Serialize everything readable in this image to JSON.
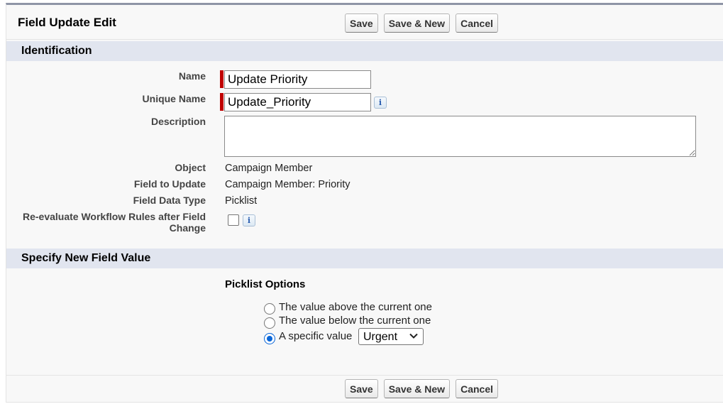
{
  "header": {
    "title": "Field Update Edit"
  },
  "buttons": {
    "save": "Save",
    "save_new": "Save & New",
    "cancel": "Cancel"
  },
  "identification": {
    "heading": "Identification",
    "name_label": "Name",
    "name_value": "Update Priority",
    "unique_name_label": "Unique Name",
    "unique_name_value": "Update_Priority",
    "description_label": "Description",
    "description_value": "",
    "object_label": "Object",
    "object_value": "Campaign Member",
    "field_to_update_label": "Field to Update",
    "field_to_update_value": "Campaign Member: Priority",
    "field_data_type_label": "Field Data Type",
    "field_data_type_value": "Picklist",
    "reevaluate_label_line1": "Re-evaluate Workflow Rules after Field",
    "reevaluate_label_line2": "Change",
    "reevaluate_checked": false,
    "info_icon_glyph": "i"
  },
  "new_value": {
    "heading": "Specify New Field Value",
    "picklist_options_title": "Picklist Options",
    "option_above": "The value above the current one",
    "option_below": "The value below the current one",
    "option_specific": "A specific value",
    "selected_option": "specific",
    "specific_value": "Urgent"
  },
  "colors": {
    "required_bar": "#c00000",
    "section_header_bg": "#e1e5ef",
    "radio_selected": "#0a66d8"
  }
}
